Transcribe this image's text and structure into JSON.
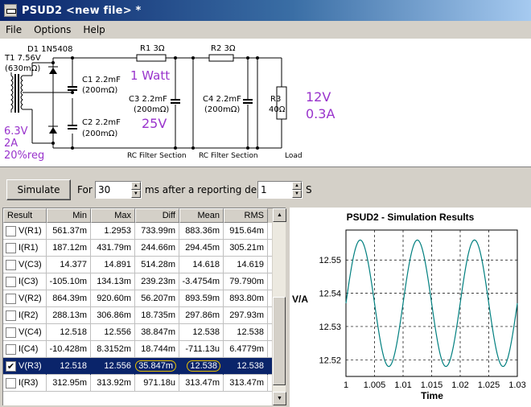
{
  "window": {
    "title": "PSUD2  <new file> *"
  },
  "menu": {
    "file": "File",
    "options": "Options",
    "help": "Help"
  },
  "schematic": {
    "transformer": "T1 7.56V",
    "transformer_res": "(630mΩ)",
    "diode": "D1 1N5408",
    "c1": "C1 2.2mF",
    "c1_res": "(200mΩ)",
    "c2": "C2 2.2mF",
    "c2_res": "(200mΩ)",
    "r1": "R1 3Ω",
    "c3": "C3 2.2mF",
    "c3_res": "(200mΩ)",
    "r2": "R2 3Ω",
    "c4": "C4 2.2mF",
    "c4_res": "(200mΩ)",
    "r3": "R3",
    "r3_val": "40Ω",
    "section1": "RC Filter Section",
    "section2": "RC Filter Section",
    "load": "Load",
    "note_watt": "1 Watt",
    "note_25v": "25V",
    "note_12v": "12V",
    "note_03a": "0.3A",
    "note_63v": "6.3V",
    "note_2a": "2A",
    "note_reg": "20%reg",
    "note_color": "#9933cc"
  },
  "simulate": {
    "button": "Simulate",
    "for_label": "For",
    "duration": "30",
    "ms_label": "ms  after a reporting delay of",
    "delay": "1",
    "s_label": "S"
  },
  "results": {
    "headers": [
      "Result",
      "Min",
      "Max",
      "Diff",
      "Mean",
      "RMS"
    ],
    "rows": [
      {
        "name": "V(R1)",
        "min": "561.37m",
        "max": "1.2953",
        "diff": "733.99m",
        "mean": "883.36m",
        "rms": "915.64m",
        "checked": ""
      },
      {
        "name": "I(R1)",
        "min": "187.12m",
        "max": "431.79m",
        "diff": "244.66m",
        "mean": "294.45m",
        "rms": "305.21m",
        "checked": ""
      },
      {
        "name": "V(C3)",
        "min": "14.377",
        "max": "14.891",
        "diff": "514.28m",
        "mean": "14.618",
        "rms": "14.619",
        "checked": ""
      },
      {
        "name": "I(C3)",
        "min": "-105.10m",
        "max": "134.13m",
        "diff": "239.23m",
        "mean": "-3.4754m",
        "rms": "79.790m",
        "checked": ""
      },
      {
        "name": "V(R2)",
        "min": "864.39m",
        "max": "920.60m",
        "diff": "56.207m",
        "mean": "893.59m",
        "rms": "893.80m",
        "checked": ""
      },
      {
        "name": "I(R2)",
        "min": "288.13m",
        "max": "306.86m",
        "diff": "18.735m",
        "mean": "297.86m",
        "rms": "297.93m",
        "checked": ""
      },
      {
        "name": "V(C4)",
        "min": "12.518",
        "max": "12.556",
        "diff": "38.847m",
        "mean": "12.538",
        "rms": "12.538",
        "checked": ""
      },
      {
        "name": "I(C4)",
        "min": "-10.428m",
        "max": "8.3152m",
        "diff": "18.744m",
        "mean": "-711.13u",
        "rms": "6.4779m",
        "checked": ""
      },
      {
        "name": "V(R3)",
        "min": "12.518",
        "max": "12.556",
        "diff": "35.847m",
        "mean": "12.538",
        "rms": "12.538",
        "checked": "✔"
      },
      {
        "name": "I(R3)",
        "min": "312.95m",
        "max": "313.92m",
        "diff": "971.18u",
        "mean": "313.47m",
        "rms": "313.47m",
        "checked": ""
      }
    ]
  },
  "chart_data": {
    "type": "line",
    "title": "PSUD2 - Simulation Results",
    "xlabel": "Time",
    "ylabel": "V/A",
    "xlim": [
      1,
      1.03
    ],
    "ylim": [
      12.515,
      12.559
    ],
    "xticks": [
      "1",
      "1.005",
      "1.01",
      "1.015",
      "1.02",
      "1.025",
      "1.03"
    ],
    "yticks": [
      "12.55",
      "12.54",
      "12.53",
      "12.52"
    ],
    "grid": true,
    "series": [
      {
        "color": "#007f7f",
        "waveform": "sine",
        "period": 0.01,
        "phase_peak_at": 1.0025,
        "min": 12.518,
        "max": 12.556
      }
    ]
  },
  "highlight": {
    "color": "#e8c000"
  }
}
